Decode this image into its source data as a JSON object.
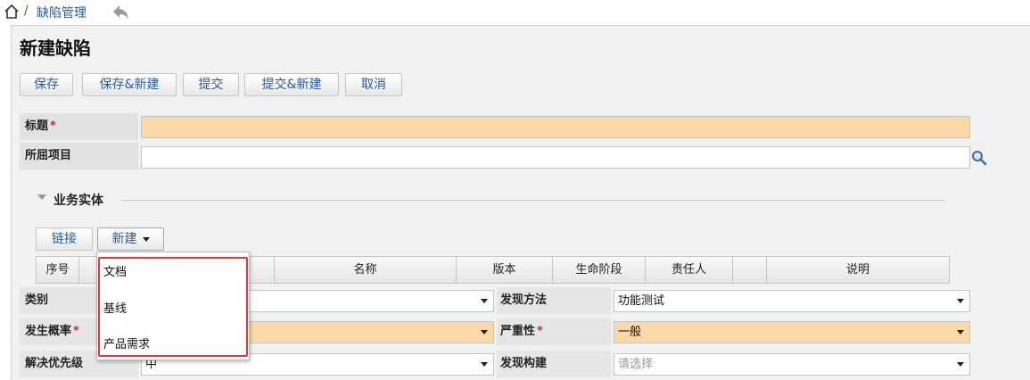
{
  "breadcrumb": {
    "separator": "/",
    "link": "缺陷管理"
  },
  "page": {
    "title": "新建缺陷"
  },
  "toolbar": {
    "save": "保存",
    "save_new": "保存&新建",
    "submit": "提交",
    "submit_new": "提交&新建",
    "cancel": "取消"
  },
  "fields": {
    "title_label": "标题",
    "required_mark": "*",
    "project_label": "所屈项目"
  },
  "section": {
    "title": "业务实体"
  },
  "entity_toolbar": {
    "link": "链接",
    "new": "新建"
  },
  "table": {
    "columns": [
      "序号",
      "名称",
      "版本",
      "生命阶段",
      "责任人",
      "说明"
    ]
  },
  "dropdown": {
    "items": [
      "文档",
      "基线",
      "产品需求"
    ]
  },
  "form_rows": {
    "category_label": "类别",
    "discover_method_label": "发现方法",
    "discover_method_value": "功能测试",
    "probability_label": "发生概率",
    "severity_label": "严重性",
    "severity_value": "一般",
    "priority_label": "解决优先级",
    "priority_value": "中",
    "build_label": "发现构建",
    "build_placeholder": "请选择"
  },
  "colors": {
    "required_bg": "#fcd8a6",
    "link_blue": "#2a5d9c",
    "highlight_red": "#e0353b"
  }
}
